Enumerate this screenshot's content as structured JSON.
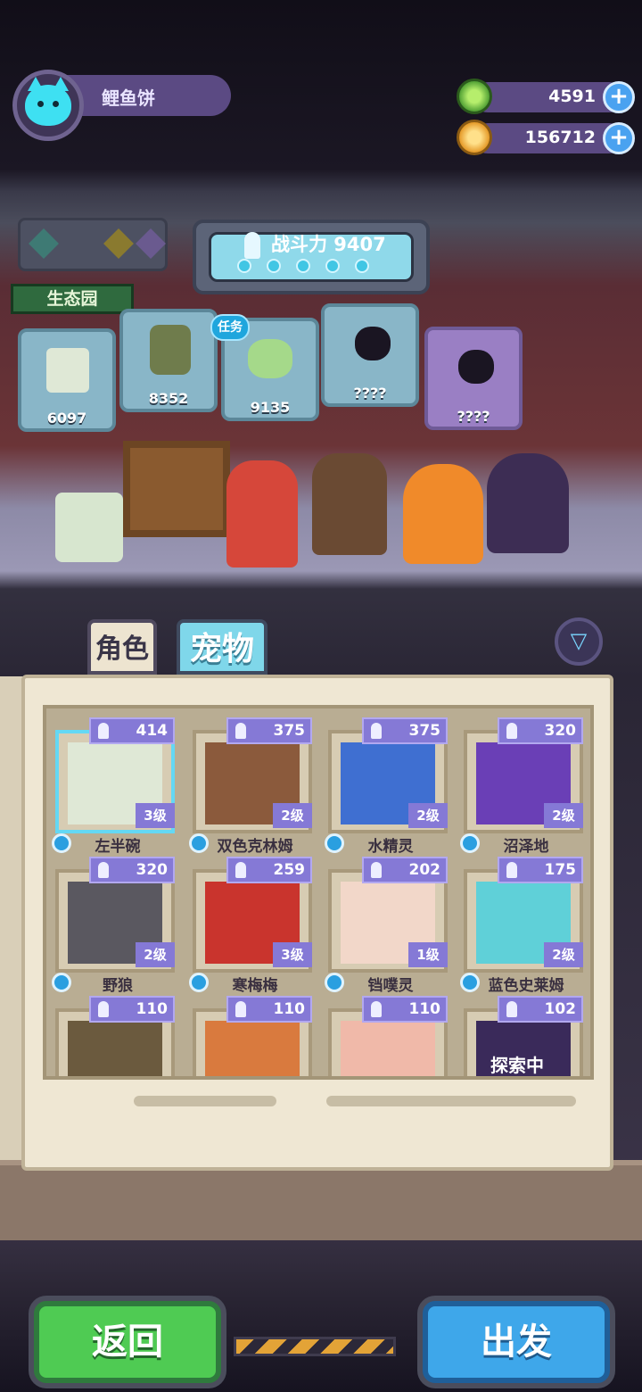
{
  "player": {
    "name": "鲤鱼饼"
  },
  "currencies": [
    {
      "name": "green-gem",
      "value": "4591",
      "color": "#7bd24a"
    },
    {
      "name": "gold-planet",
      "value": "156712",
      "color": "#f0b93a"
    }
  ],
  "power": {
    "label": "战斗力 9407",
    "dots": 5
  },
  "eco_sign": "生态园",
  "task_badge": "任务",
  "display_pets": [
    {
      "count": "6097"
    },
    {
      "count": "8352"
    },
    {
      "count": "9135"
    },
    {
      "count": "????",
      "unknown": true
    },
    {
      "count": "????",
      "unknown": true
    }
  ],
  "tabs": {
    "character": "角色",
    "pet": "宠物"
  },
  "pets": [
    {
      "name": "左半碗",
      "power": "414",
      "level": "3级",
      "art_color": "#dfe8d6",
      "selected": true
    },
    {
      "name": "双色克林姆",
      "power": "375",
      "level": "2级",
      "art_color": "#8b5a3c"
    },
    {
      "name": "水精灵",
      "power": "375",
      "level": "2级",
      "art_color": "#3f6fd1"
    },
    {
      "name": "沼泽地",
      "power": "320",
      "level": "2级",
      "art_color": "#6a3fb6"
    },
    {
      "name": "野狼",
      "power": "320",
      "level": "2级",
      "art_color": "#5a5860"
    },
    {
      "name": "寒梅梅",
      "power": "259",
      "level": "3级",
      "art_color": "#c9342d"
    },
    {
      "name": "铛噗灵",
      "power": "202",
      "level": "1级",
      "art_color": "#f2d7c9"
    },
    {
      "name": "蓝色史莱姆",
      "power": "175",
      "level": "2级",
      "art_color": "#5fd0d8"
    },
    {
      "name": "",
      "power": "110",
      "level": "",
      "art_color": "#6b5a3e"
    },
    {
      "name": "",
      "power": "110",
      "level": "",
      "art_color": "#d97a3e"
    },
    {
      "name": "",
      "power": "110",
      "level": "",
      "art_color": "#f0b9a9"
    },
    {
      "name": "",
      "power": "102",
      "level": "",
      "art_color": "#3a2a5a",
      "status": "探索中"
    }
  ],
  "buttons": {
    "back": "返回",
    "go": "出发"
  }
}
